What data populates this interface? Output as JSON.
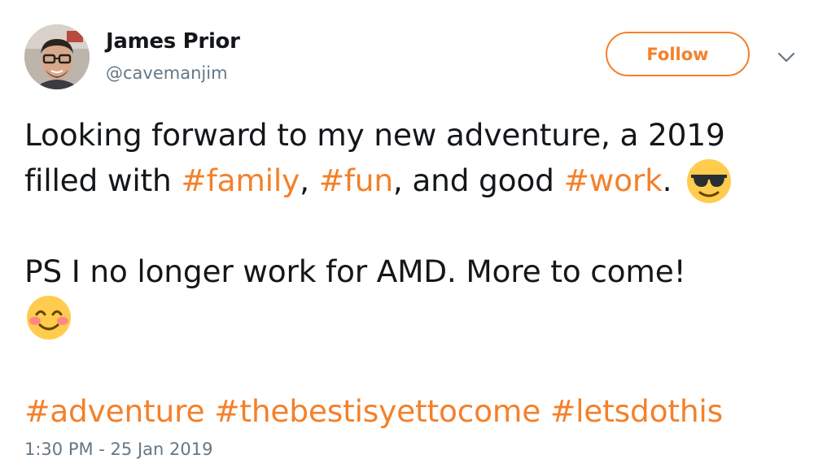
{
  "user": {
    "display_name": "James Prior",
    "handle": "@cavemanjim"
  },
  "actions": {
    "follow_label": "Follow"
  },
  "tweet": {
    "line1": "Looking forward to my new adventure, a 2019",
    "line2_before": "filled with ",
    "hashtag_family": "#family",
    "comma1": ", ",
    "hashtag_fun": "#fun",
    "line2_middle": ", and good ",
    "hashtag_work": "#work",
    "line2_end": ".",
    "line3": "PS I no longer work for AMD. More to come!",
    "hashtag_adventure": "#adventure",
    "hashtag_thebest": "#thebestisyettocome",
    "hashtag_lets": "#letsdothis",
    "timestamp": "1:30 PM - 25 Jan 2019"
  },
  "icons": {
    "first_emoji": "sunglasses-emoji-icon",
    "second_emoji": "smiling-blush-emoji-icon",
    "caret": "chevron-down-icon"
  },
  "colors": {
    "accent": "#f4802a",
    "text": "#14171a",
    "secondary_text": "#657786"
  }
}
